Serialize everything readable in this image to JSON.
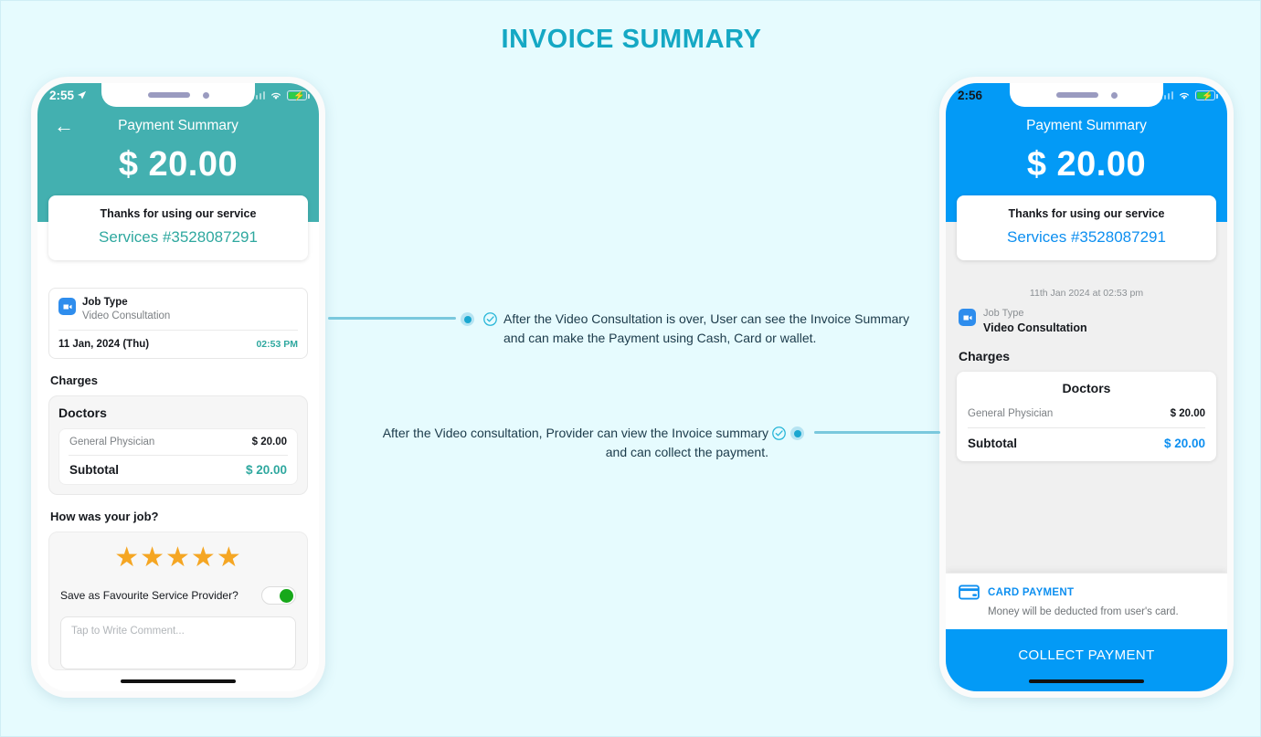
{
  "page": {
    "title": "INVOICE SUMMARY",
    "background_color": "#e6fbfe",
    "title_color": "#15a8c4"
  },
  "annotations": [
    {
      "id": "user-flow",
      "text": "After the Video Consultation is over, User can see the Invoice Summary and can make the Payment using Cash, Card or wallet.",
      "line1": "After the Video Consultation is over, User can see the Invoice Summary",
      "line2": "and can make the Payment using Cash, Card or wallet.",
      "align": "left"
    },
    {
      "id": "provider-flow",
      "text": "After the Video consultation, Provider can view the Invoice summary and can collect the payment.",
      "line1": "After the Video consultation, Provider can view the Invoice summary",
      "line2": "and can collect the payment.",
      "align": "right"
    }
  ],
  "left_phone": {
    "accent_color": "#43b0b0",
    "status_bar": {
      "time": "2:55",
      "location_icon": "navigation-arrow-icon",
      "wifi": "wifi-icon",
      "battery": "battery-charging-icon"
    },
    "nav": {
      "back": "←",
      "title": "Payment Summary"
    },
    "amount": "$ 20.00",
    "thanks_card": {
      "heading": "Thanks for using our service",
      "service_id": "Services #3528087291"
    },
    "job": {
      "icon": "video-camera-icon",
      "label": "Job Type",
      "value": "Video Consultation",
      "date": "11 Jan, 2024 (Thu)",
      "time": "02:53 PM"
    },
    "charges": {
      "section_title": "Charges",
      "group_title": "Doctors",
      "rows": [
        {
          "name": "General Physician",
          "amount": "$ 20.00"
        }
      ],
      "subtotal_label": "Subtotal",
      "subtotal_amount": "$ 20.00"
    },
    "rating": {
      "question": "How was your job?",
      "stars": "★★★★★",
      "star_count": 5,
      "favourite_label": "Save as Favourite Service Provider?",
      "toggle_state": "on",
      "comment_placeholder": "Tap to Write Comment..."
    }
  },
  "right_phone": {
    "accent_color": "#039af6",
    "status_bar": {
      "time": "2:56",
      "wifi": "wifi-icon",
      "battery": "battery-charging-icon"
    },
    "nav": {
      "title": "Payment Summary"
    },
    "amount": "$ 20.00",
    "thanks_card": {
      "heading": "Thanks for using our service",
      "service_id": "Services #3528087291"
    },
    "datetime": "11th Jan 2024 at 02:53 pm",
    "job": {
      "icon": "video-camera-icon",
      "label": "Job Type",
      "value": "Video Consultation"
    },
    "charges": {
      "section_title": "Charges",
      "group_title": "Doctors",
      "rows": [
        {
          "name": "General Physician",
          "amount": "$ 20.00"
        }
      ],
      "subtotal_label": "Subtotal",
      "subtotal_amount": "$ 20.00"
    },
    "payment": {
      "icon": "credit-card-icon",
      "title": "CARD PAYMENT",
      "subtitle": "Money will be deducted from user's card.",
      "button_label": "COLLECT PAYMENT"
    }
  }
}
